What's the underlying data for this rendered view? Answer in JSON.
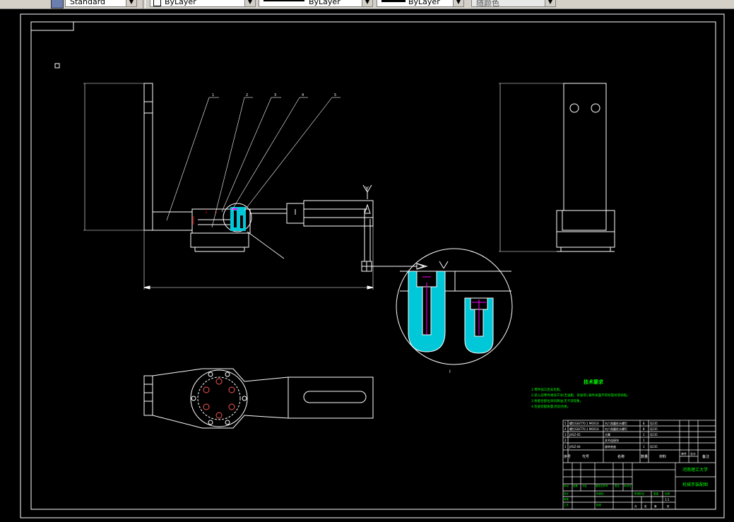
{
  "toolbar": {
    "text_style": "Standard",
    "layer": "ByLayer",
    "linetype": "ByLayer",
    "lineweight": "ByLayer",
    "plot_color": "随颜色"
  },
  "drawing": {
    "part_numbers": [
      "1",
      "2",
      "3",
      "4",
      "5"
    ],
    "section_label": "I",
    "weld_symbol": "Y",
    "tech_requirements_title": "技术要求",
    "tech_requirements": [
      "1.零件加工后去毛刺。",
      "2.装入前零件清洗干净(无油脂、杂质等),铸件表面不得有裂纹等缺陷。",
      "3.各配合部位涂润滑油,无卡滞现象。",
      "4.检查装配质量,检验合格。"
    ],
    "bom_rows": [
      [
        "5",
        "螺钉GB/T70.1 M6X16",
        "内六角圆柱头螺钉",
        "8",
        "Q235"
      ],
      [
        "4",
        "螺钉GB/T70.1 M6X16",
        "内六角圆柱头螺钉",
        "8",
        "Q235"
      ],
      [
        "3",
        "JXSZ-05",
        "大臂",
        "1",
        "Q235"
      ],
      [
        "2",
        "",
        "关节连接块",
        "1",
        ""
      ],
      [
        "1",
        "JXSZ-04",
        "旋转底座",
        "1",
        "Q235"
      ]
    ],
    "bom_header": [
      "序号",
      "代号",
      "名称",
      "数量",
      "材料",
      "单件",
      "总计",
      "备注"
    ],
    "university": "河南理工大学",
    "drawing_title": "机械手装配图",
    "title_labels": [
      "标记",
      "处数",
      "分区",
      "更改文件号",
      "签名",
      "年月日",
      "设计",
      "标准化",
      "审核",
      "工艺",
      "批准",
      "阶段标记",
      "重量",
      "比例"
    ],
    "scale": "1:1",
    "sheet_labels": [
      "共",
      "张",
      "第",
      "张"
    ]
  },
  "colors": {
    "background": "#000000",
    "lines": "#ffffff",
    "hatch": "#00e5ff",
    "bolt": "#ff00ff",
    "text_green": "#00ff00",
    "hidden": "#ff0000"
  }
}
